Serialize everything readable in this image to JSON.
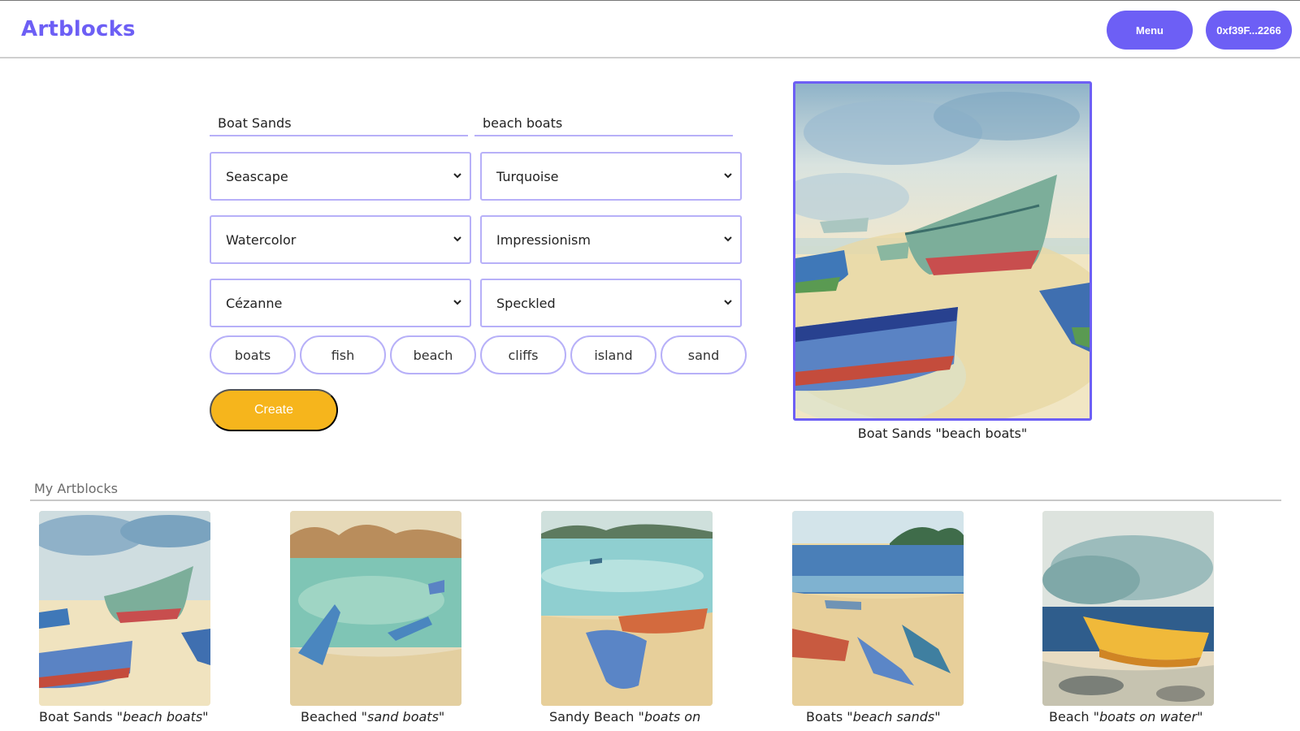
{
  "header": {
    "logo": "Artblocks",
    "menu_label": "Menu",
    "wallet_label": "0xf39F...2266"
  },
  "form": {
    "title_value": "Boat Sands",
    "subtitle_value": "beach boats",
    "selects": [
      {
        "value": "Seascape"
      },
      {
        "value": "Turquoise"
      },
      {
        "value": "Watercolor"
      },
      {
        "value": "Impressionism"
      },
      {
        "value": "Cézanne"
      },
      {
        "value": "Speckled"
      }
    ],
    "tags": [
      "boats",
      "fish",
      "beach",
      "cliffs",
      "island",
      "sand"
    ],
    "create_label": "Create"
  },
  "preview": {
    "caption": "Boat Sands \"beach boats\""
  },
  "gallery": {
    "title": "My Artblocks",
    "items": [
      {
        "name": "Boat Sands",
        "subtitle": "\"beach boats\""
      },
      {
        "name": "Beached",
        "subtitle": "\"sand boats\""
      },
      {
        "name": "Sandy Beach",
        "subtitle": "\"boats on"
      },
      {
        "name": "Boats",
        "subtitle": "\"beach sands\""
      },
      {
        "name": "Beach",
        "subtitle": "\"boats on water\""
      }
    ]
  },
  "colors": {
    "accent": "#6d5ff5",
    "accent_light": "#b7b0f8",
    "create_button": "#f6b51c"
  },
  "icons": [
    "chevron-down-icon"
  ]
}
